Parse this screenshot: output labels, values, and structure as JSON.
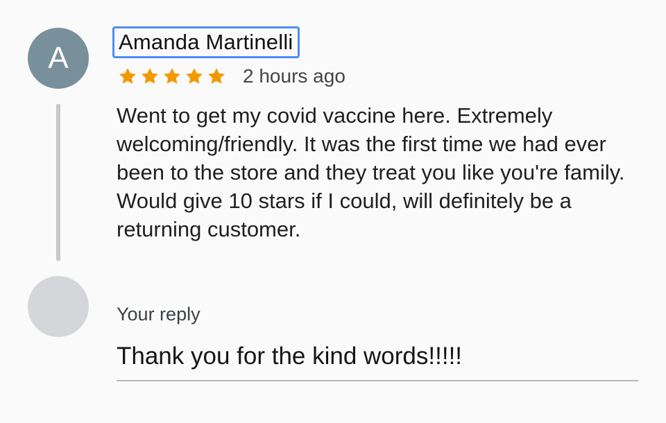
{
  "review": {
    "reviewer_initial": "A",
    "reviewer_name": "Amanda Martinelli",
    "rating": 5,
    "rating_max": 5,
    "star_color": "#f29900",
    "time_ago": "2 hours ago",
    "text": "Went to get my covid vaccine here. Extremely welcoming/friendly. It was the first time we had ever been to the store and they treat you like you're family. Would give 10 stars if I could, will definitely be a returning customer."
  },
  "reply": {
    "label": "Your reply",
    "text": "Thank you for the kind words!!!!!"
  },
  "colors": {
    "background": "#fafafa",
    "avatar_reviewer": "#78909c",
    "avatar_reply": "#d4d6da",
    "name_focus_border": "#4c8df6",
    "thread_line": "#c7c7c7",
    "reply_underline": "#b8b8b8"
  },
  "icons": {
    "star": "star-icon"
  }
}
